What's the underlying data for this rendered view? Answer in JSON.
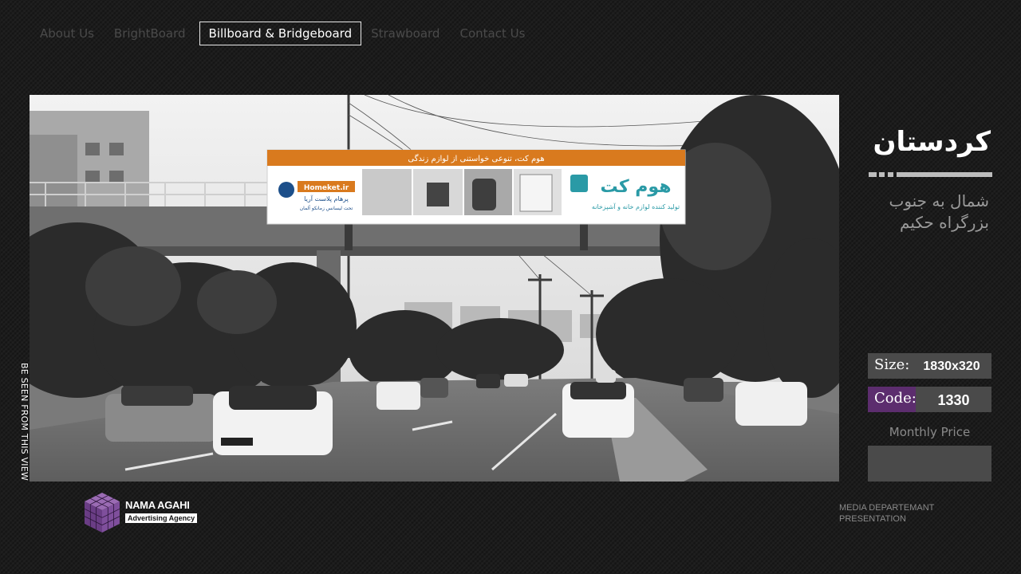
{
  "nav": {
    "items": [
      {
        "label": "About Us"
      },
      {
        "label": "BrightBoard"
      },
      {
        "label": "Billboard & Bridgeboard"
      },
      {
        "label": "Strawboard"
      },
      {
        "label": "Contact Us"
      }
    ],
    "active_index": 2
  },
  "billboard_ad": {
    "headline": "هوم کت، تنوعی خواستنی از لوازم زندگی",
    "brand": "هوم کت",
    "tagline": "تولید کننده لوازم خانه و آشپزخانه",
    "website": "Homeket.ir",
    "company": "پرهام پلاست آریا",
    "license": "تحت لیسانس زمانکو آلمان"
  },
  "side_caption": "Be seen from this view",
  "info": {
    "city": "کردستان",
    "location_line1": "شمال به جنوب",
    "location_line2": "بزرگراه حکیم",
    "size_label": "Size:",
    "size_value": "1830x320",
    "code_label": "Code:",
    "code_value": "1330",
    "price_label": "Monthly Price",
    "price_value": ""
  },
  "footer": {
    "logo_name": "NAMA AGAHI",
    "logo_tagline": "Advertising Agency",
    "note": "MEDIA DEPARTEMANT\nPRESENTATION"
  },
  "colors": {
    "background": "#1c1c1c",
    "code_accent": "#5c2d6e",
    "panel_box": "#4a4a4a",
    "ad_orange": "#d97a1e",
    "logo_purple": "#7a4a94"
  }
}
